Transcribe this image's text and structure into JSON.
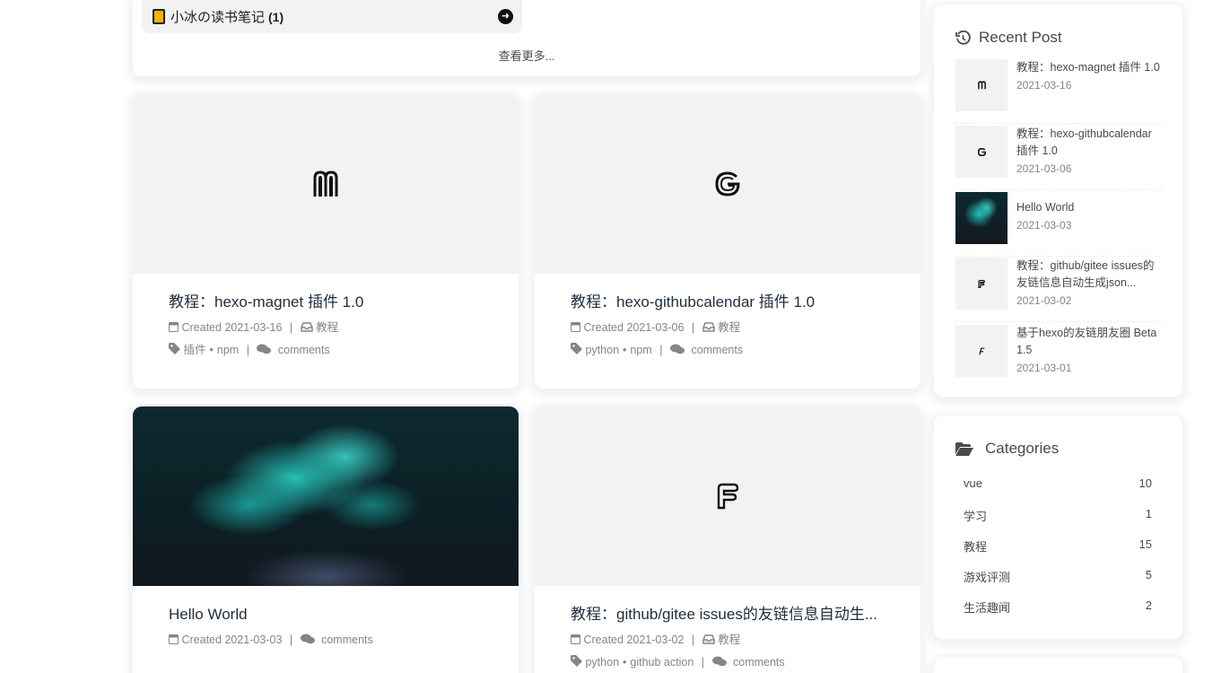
{
  "douban": {
    "book_label": "小冰の读书笔记",
    "book_count": "(1)",
    "more": "查看更多..."
  },
  "posts": [
    {
      "title": "教程：hexo-magnet 插件 1.0",
      "created_prefix": "Created",
      "date": "2021-03-16",
      "category": "教程",
      "tags": [
        "插件",
        "npm"
      ],
      "comments": "comments",
      "cover_icon": "magnet-logo-icon"
    },
    {
      "title": "教程：hexo-githubcalendar 插件 1.0",
      "created_prefix": "Created",
      "date": "2021-03-06",
      "category": "教程",
      "tags": [
        "python",
        "npm"
      ],
      "comments": "comments",
      "cover_icon": "g-logo-icon"
    },
    {
      "title": "Hello World",
      "created_prefix": "Created",
      "date": "2021-03-03",
      "comments": "comments",
      "cover_icon": "smoke-photo"
    },
    {
      "title": "教程：github/gitee issues的友链信息自动生...",
      "created_prefix": "Created",
      "date": "2021-03-02",
      "category": "教程",
      "tags": [
        "python",
        "github action"
      ],
      "comments": "comments",
      "cover_icon": "f-logo-icon"
    }
  ],
  "recent": {
    "heading": "Recent Post",
    "items": [
      {
        "title": "教程：hexo-magnet 插件 1.0",
        "date": "2021-03-16"
      },
      {
        "title": "教程：hexo-githubcalendar 插件 1.0",
        "date": "2021-03-06"
      },
      {
        "title": "Hello World",
        "date": "2021-03-03"
      },
      {
        "title": "教程：github/gitee issues的友链信息自动生成json...",
        "date": "2021-03-02"
      },
      {
        "title": "基于hexo的友链朋友圈 Beta1.5",
        "date": "2021-03-01"
      }
    ]
  },
  "categories": {
    "heading": "Categories",
    "items": [
      {
        "name": "vue",
        "count": "10"
      },
      {
        "name": "学习",
        "count": "1"
      },
      {
        "name": "教程",
        "count": "15"
      },
      {
        "name": "游戏评测",
        "count": "5"
      },
      {
        "name": "生活趣闻",
        "count": "2"
      }
    ]
  }
}
